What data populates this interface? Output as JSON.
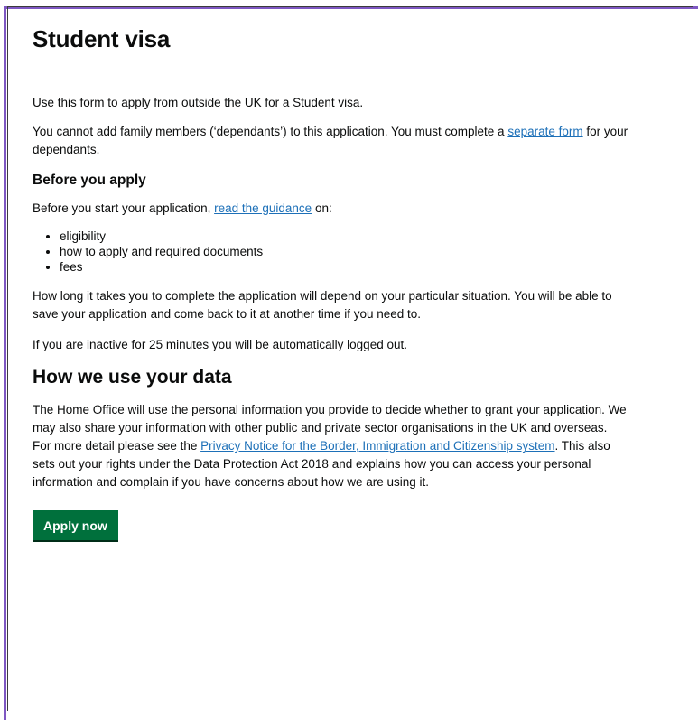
{
  "page": {
    "title": "Student visa",
    "intro": "Use this form to apply from outside the UK for a Student visa.",
    "dependants": {
      "before": "You cannot add family members (‘dependants’) to this application. You must complete a ",
      "link": "separate form",
      "after": " for your dependants."
    },
    "before_apply": {
      "heading": "Before you apply",
      "lead_before": "Before you start your application, ",
      "lead_link": "read the guidance",
      "lead_after": " on:",
      "items": [
        "eligibility",
        "how to apply and required documents",
        "fees"
      ],
      "duration": "How long it takes you to complete the application will depend on your particular situation. You will be able to save your application and come back to it at another time if you need to.",
      "inactive": "If you are inactive for 25 minutes you will be automatically logged out."
    },
    "data_use": {
      "heading": "How we use your data",
      "text_before": "The Home Office will use the personal information you provide to decide whether to grant your application. We may also share your information with other public and private sector organisations in the UK and overseas. For more detail please see the ",
      "link": "Privacy Notice for the Border, Immigration and Citizenship system",
      "text_after": ". This also sets out your rights under the Data Protection Act 2018 and explains how you can access your personal information and complain if you have concerns about how we are using it."
    },
    "apply_button": "Apply now",
    "colors": {
      "link": "#1d70b8",
      "button": "#00703c",
      "frame": "#7e57c2"
    }
  }
}
